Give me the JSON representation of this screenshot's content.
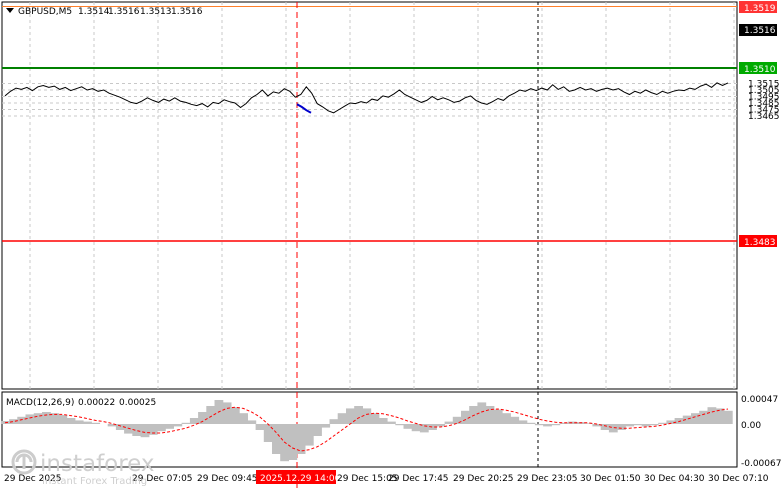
{
  "header": {
    "symbol": "GBPUSD,M5",
    "open": "1.3514",
    "high": "1.3516",
    "low": "1.3513",
    "close": "1.3516"
  },
  "macd": {
    "label": "MACD(12,26,9)",
    "main": "0.00022",
    "signal": "0.00025",
    "axis_ticks": [
      0.00047,
      0.0,
      -0.00067
    ],
    "axis_labels": [
      "0.00047",
      "0.00",
      "-0.00067"
    ]
  },
  "levels": {
    "top": {
      "label": "1.3519",
      "color": "#ff7f2a"
    },
    "green": {
      "label": "1.3510",
      "color": "#008000"
    },
    "red": {
      "label": "1.3483",
      "color": "#ff0000"
    },
    "current": {
      "label": "1.3516",
      "color": "#000000"
    }
  },
  "y_axis_labels": [
    "1.3515",
    "1.3505",
    "1.3495",
    "1.3485",
    "1.3475",
    "1.3465"
  ],
  "x_axis_labels": [
    "29 Dec 2025",
    "29 Dec 07:05",
    "29 Dec 09:45",
    "2025.12.29 14:00",
    "29 Dec 15:05",
    "29 Dec 17:45",
    "29 Dec 20:25",
    "29 Dec 23:05",
    "30 Dec 01:50",
    "30 Dec 04:30",
    "30 Dec 07:10"
  ],
  "watermark": {
    "brand": "instaforex",
    "tagline": "Instant Forex Trading"
  },
  "colors": {
    "price_line": "#000000",
    "highlight_segment": "#0000cc",
    "grid": "#c8c8c8",
    "macd_hist": "#c0c0c0",
    "macd_signal": "#ff0000",
    "crosshair_red": "#ff0000"
  },
  "chart_data": {
    "type": "line",
    "title": "GBPUSD,M5",
    "ylim": [
      1.3458,
      1.3522
    ],
    "price": [
      1.3496,
      1.3503,
      1.3508,
      1.3506,
      1.3509,
      1.3504,
      1.351,
      1.3512,
      1.3509,
      1.3511,
      1.3506,
      1.3509,
      1.3504,
      1.3507,
      1.351,
      1.3505,
      1.3507,
      1.3503,
      1.3505,
      1.35,
      1.3497,
      1.3494,
      1.349,
      1.3486,
      1.3484,
      1.3488,
      1.3493,
      1.3489,
      1.3486,
      1.3491,
      1.3488,
      1.3493,
      1.3488,
      1.3486,
      1.3483,
      1.3481,
      1.3484,
      1.3479,
      1.3486,
      1.3484,
      1.349,
      1.3487,
      1.3485,
      1.3478,
      1.3484,
      1.3493,
      1.3498,
      1.3505,
      1.3496,
      1.3502,
      1.35,
      1.3507,
      1.3503,
      1.3494,
      1.3498,
      1.351,
      1.35,
      1.3484,
      1.3479,
      1.3473,
      1.347,
      1.3475,
      1.348,
      1.3485,
      1.3484,
      1.3487,
      1.3485,
      1.3491,
      1.3489,
      1.3496,
      1.3494,
      1.3499,
      1.3505,
      1.3498,
      1.3494,
      1.349,
      1.3486,
      1.3489,
      1.3495,
      1.349,
      1.3493,
      1.349,
      1.3486,
      1.3488,
      1.3493,
      1.3496,
      1.3489,
      1.3485,
      1.3483,
      1.3487,
      1.3492,
      1.3489,
      1.3496,
      1.35,
      1.3505,
      1.3503,
      1.3507,
      1.3504,
      1.3508,
      1.3505,
      1.3513,
      1.3506,
      1.351,
      1.3503,
      1.3505,
      1.3509,
      1.3505,
      1.3507,
      1.3503,
      1.3506,
      1.3508,
      1.3505,
      1.3507,
      1.3502,
      1.3498,
      1.3503,
      1.35,
      1.3505,
      1.3501,
      1.3498,
      1.3503,
      1.35,
      1.3503,
      1.3505,
      1.3504,
      1.3508,
      1.3506,
      1.3511,
      1.3514,
      1.3509,
      1.3516,
      1.3512,
      1.3516
    ],
    "highlight_segment": [
      1.3483,
      1.3479,
      1.3474,
      1.347
    ],
    "macd_histogram": [
      5e-05,
      8e-05,
      0.00012,
      0.00016,
      0.00018,
      0.0002,
      0.00018,
      0.00015,
      0.0001,
      6e-05,
      4e-05,
      2e-05,
      0.0,
      -4e-05,
      -0.0001,
      -0.00016,
      -0.0002,
      -0.00022,
      -0.00018,
      -0.00012,
      -8e-05,
      -4e-05,
      2e-05,
      0.0001,
      0.0002,
      0.0003,
      0.0004,
      0.00036,
      0.00028,
      0.00018,
      6e-05,
      -0.0001,
      -0.0003,
      -0.0005,
      -0.00062,
      -0.0006,
      -0.0005,
      -0.00036,
      -0.0002,
      -6e-05,
      8e-05,
      0.00018,
      0.00026,
      0.0003,
      0.00026,
      0.00018,
      0.0001,
      4e-05,
      -2e-05,
      -8e-05,
      -0.00012,
      -0.00014,
      -0.0001,
      -4e-05,
      4e-05,
      0.00012,
      0.00022,
      0.0003,
      0.00036,
      0.0003,
      0.00024,
      0.00018,
      0.00012,
      6e-05,
      2e-05,
      -2e-05,
      -4e-05,
      -2e-05,
      2e-05,
      4e-05,
      3e-05,
      1e-05,
      -4e-05,
      -0.0001,
      -0.00014,
      -0.0001,
      -4e-05,
      -2e-05,
      -4e-05,
      -2e-05,
      2e-05,
      6e-05,
      0.0001,
      0.00014,
      0.00018,
      0.00022,
      0.00028,
      0.00026,
      0.00022
    ],
    "macd_signal": [
      2e-05,
      4e-05,
      7e-05,
      0.0001,
      0.00013,
      0.00015,
      0.00016,
      0.00016,
      0.00014,
      0.00012,
      9e-05,
      6e-05,
      4e-05,
      1e-05,
      -3e-05,
      -7e-05,
      -0.00011,
      -0.00014,
      -0.00015,
      -0.00015,
      -0.00013,
      -0.0001,
      -7e-05,
      -2e-05,
      4e-05,
      0.00012,
      0.0002,
      0.00026,
      0.00028,
      0.00026,
      0.0002,
      0.00012,
      0.0,
      -0.00014,
      -0.0003,
      -0.0004,
      -0.00045,
      -0.00043,
      -0.00038,
      -0.0003,
      -0.0002,
      -0.0001,
      0.0,
      0.0001,
      0.00016,
      0.00018,
      0.00017,
      0.00014,
      0.0001,
      5e-05,
      1e-05,
      -3e-05,
      -5e-05,
      -5e-05,
      -3e-05,
      1e-05,
      7e-05,
      0.00014,
      0.0002,
      0.00024,
      0.00025,
      0.00023,
      0.0002,
      0.00016,
      0.00012,
      8e-05,
      5e-05,
      3e-05,
      2e-05,
      2e-05,
      2e-05,
      2e-05,
      0.0,
      -3e-05,
      -6e-05,
      -7e-05,
      -7e-05,
      -6e-05,
      -5e-05,
      -4e-05,
      -2e-05,
      1e-05,
      4e-05,
      8e-05,
      0.00012,
      0.00016,
      0.0002,
      0.00023,
      0.00025
    ]
  }
}
